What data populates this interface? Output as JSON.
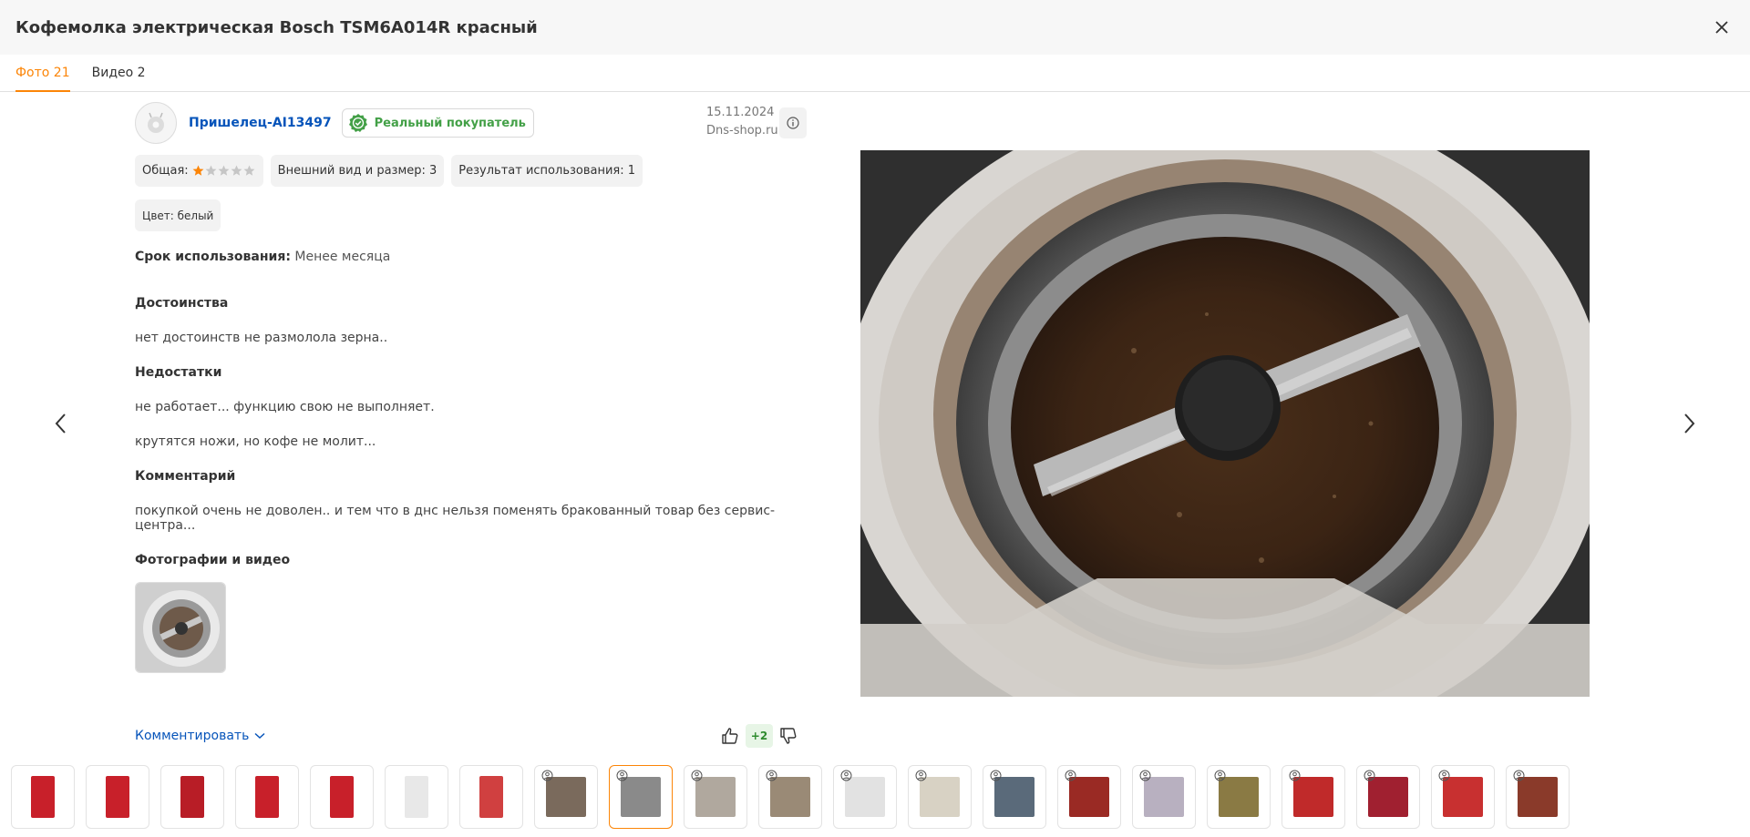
{
  "header": {
    "title": "Кофемолка электрическая Bosch TSM6A014R красный"
  },
  "tabs": [
    {
      "label": "Фото 21",
      "active": true
    },
    {
      "label": "Видео 2",
      "active": false
    }
  ],
  "review": {
    "author": "Пришелец-AI13497",
    "badge": "Реальный покупатель",
    "date": "15.11.2024",
    "source": "Dns-shop.ru",
    "ratings": {
      "overall_label": "Общая:",
      "overall_stars": 1,
      "stars_max": 5,
      "appearance": "Внешний вид и размер: 3",
      "usage_result": "Результат использования: 1"
    },
    "color": "Цвет: белый",
    "usage_term_label": "Срок использования:",
    "usage_term_value": "Менее месяца",
    "pros_title": "Достоинства",
    "pros_text": "нет достоинств не размолола зерна..",
    "cons_title": "Недостатки",
    "cons_text_1": "не работает... функцию свою не выполняет.",
    "cons_text_2": "крутятся ножи, но кофе не молит...",
    "comment_title": "Комментарий",
    "comment_text": "покупкой очень не доволен.. и тем что в днс нельзя поменять бракованный товар без сервис-центра...",
    "media_title": "Фотографии и видео"
  },
  "actions": {
    "comment_label": "Комментировать",
    "vote_count": "+2"
  },
  "colors": {
    "accent": "#fc8507",
    "link": "#0654ba",
    "badge_green": "#43a047"
  },
  "thumbnails_count": 21,
  "active_thumbnail": 8
}
